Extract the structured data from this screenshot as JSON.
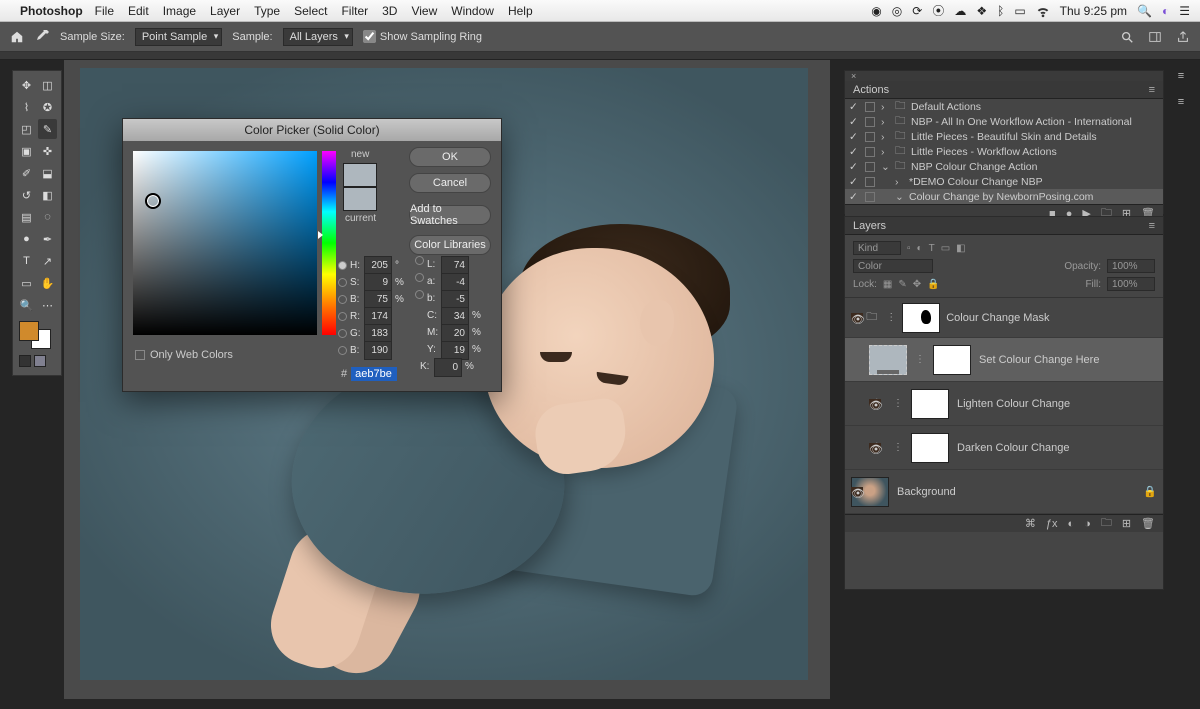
{
  "mac_menu": {
    "app": "Photoshop",
    "items": [
      "File",
      "Edit",
      "Image",
      "Layer",
      "Type",
      "Select",
      "Filter",
      "3D",
      "View",
      "Window",
      "Help"
    ],
    "clock": "Thu 9:25 pm"
  },
  "options_bar": {
    "sample_size_label": "Sample Size:",
    "sample_size_value": "Point Sample",
    "sample_label": "Sample:",
    "sample_value": "All Layers",
    "show_sampling": "Show Sampling Ring"
  },
  "color_picker": {
    "title": "Color Picker (Solid Color)",
    "ok": "OK",
    "cancel": "Cancel",
    "add_swatches": "Add to Swatches",
    "color_libraries": "Color Libraries",
    "new_label": "new",
    "current_label": "current",
    "new_color": "#aeb7be",
    "current_color": "#aeb7be",
    "only_web": "Only Web Colors",
    "H_lab": "H:",
    "H": "205",
    "H_u": "°",
    "S_lab": "S:",
    "S": "9",
    "S_u": "%",
    "Bv_lab": "B:",
    "Bv": "75",
    "Bv_u": "%",
    "R_lab": "R:",
    "R": "174",
    "G_lab": "G:",
    "G": "183",
    "Bb_lab": "B:",
    "Bb": "190",
    "L_lab": "L:",
    "L": "74",
    "a_lab": "a:",
    "a": "-4",
    "b_lab": "b:",
    "b": "-5",
    "C_lab": "C:",
    "C": "34",
    "C_u": "%",
    "M_lab": "M:",
    "M": "20",
    "M_u": "%",
    "Y_lab": "Y:",
    "Y": "19",
    "Y_u": "%",
    "K_lab": "K:",
    "K": "0",
    "K_u": "%",
    "hash": "#",
    "hex": "aeb7be"
  },
  "actions_panel": {
    "title": "Actions",
    "items": [
      {
        "text": "Default Actions",
        "indent": 0,
        "folder": true,
        "caret": "›"
      },
      {
        "text": "NBP - All In One Workflow Action - International",
        "indent": 0,
        "folder": true,
        "caret": "›"
      },
      {
        "text": "Little Pieces - Beautiful Skin and Details",
        "indent": 0,
        "folder": true,
        "caret": "›"
      },
      {
        "text": "Little Pieces - Workflow Actions",
        "indent": 0,
        "folder": true,
        "caret": "›"
      },
      {
        "text": "NBP Colour Change Action",
        "indent": 0,
        "folder": true,
        "caret": "⌄"
      },
      {
        "text": "*DEMO Colour Change NBP",
        "indent": 1,
        "folder": false,
        "caret": "›"
      },
      {
        "text": "Colour Change by NewbornPosing.com",
        "indent": 1,
        "folder": false,
        "caret": "⌄",
        "selected": true
      }
    ]
  },
  "layers_panel": {
    "title": "Layers",
    "kind": "Kind",
    "blend": "Color",
    "opacity_label": "Opacity:",
    "opacity": "100%",
    "lock_label": "Lock:",
    "fill_label": "Fill:",
    "fill": "100%",
    "group": "Colour Change Mask",
    "layer1": "Set Colour Change Here",
    "layer2": "Lighten Colour Change",
    "layer3": "Darken Colour Change",
    "bg": "Background"
  },
  "swatch_fg": "#d08a2c"
}
